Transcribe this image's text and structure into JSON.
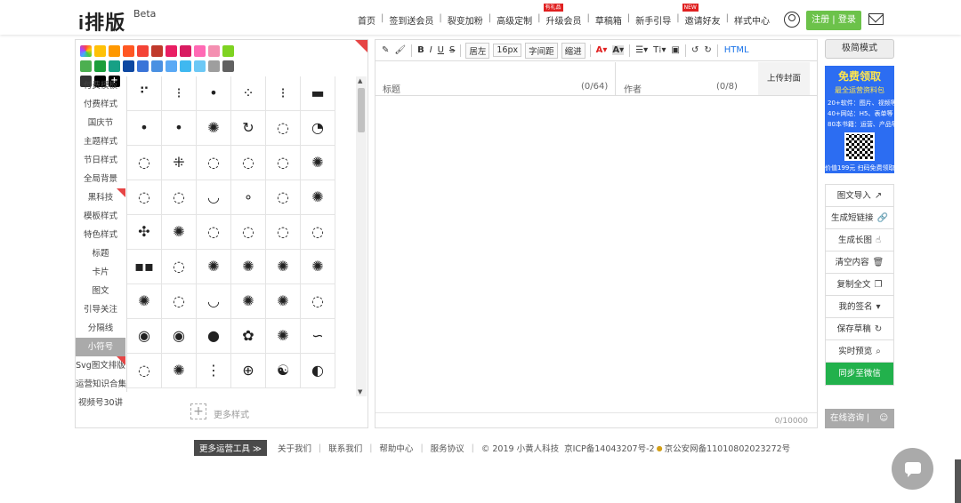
{
  "header": {
    "logo": "i排版",
    "beta": "Beta",
    "nav": [
      {
        "label": "首页"
      },
      {
        "label": "签到送会员"
      },
      {
        "label": "裂变加粉"
      },
      {
        "label": "高级定制"
      },
      {
        "label": "升级会员",
        "tag": "有礼品"
      },
      {
        "label": "草稿箱"
      },
      {
        "label": "新手引导"
      },
      {
        "label": "邀请好友",
        "tag": "NEW"
      },
      {
        "label": "样式中心"
      }
    ],
    "register_login": "注册 | 登录"
  },
  "colors": [
    "#ffffff",
    "#ffc107",
    "#ff9800",
    "#ff5722",
    "#f44336",
    "#c0392b",
    "#e91e63",
    "#d81b60",
    "#ff69b4",
    "#f48fb1",
    "#7ed321",
    "#4caf50",
    "#1a9e3a",
    "#16a085",
    "#0d47a1",
    "#3b74d8",
    "#4a90e2",
    "#5aa9f5",
    "#3fb8f0",
    "#6cc8f5",
    "#9e9e9e",
    "#616161",
    "#333333",
    "#000000"
  ],
  "categories": [
    "付费模板",
    "付费样式",
    "国庆节",
    "主题样式",
    "节日样式",
    "全局背景",
    "黑科技",
    "模板样式",
    "特色样式",
    "标题",
    "卡片",
    "图文",
    "引导关注",
    "分隔线",
    "小符号",
    "Svg图文排版",
    "运营知识合集",
    "视频号30讲"
  ],
  "active_category": "小符号",
  "grid_symbols": [
    [
      "⠋",
      "⁝",
      "•",
      "⁘",
      "⁝",
      "▬"
    ],
    [
      "•",
      "•",
      "✺",
      "↻",
      "◌",
      "◔"
    ],
    [
      "◌",
      "⁜",
      "◌",
      "◌",
      "◌",
      "✺"
    ],
    [
      "◌",
      "◌",
      "◡",
      "∘",
      "◌",
      "✺"
    ],
    [
      "✣",
      "✺",
      "◌",
      "◌",
      "◌",
      "◌"
    ],
    [
      "▪▪",
      "◌",
      "✺",
      "✺",
      "✺",
      "✺"
    ],
    [
      "✺",
      "◌",
      "◡",
      "✺",
      "✺",
      "◌"
    ],
    [
      "◉",
      "◉",
      "●",
      "✿",
      "✺",
      "∽"
    ],
    [
      "◌",
      "✺",
      "⋮",
      "⊕",
      "☯",
      "◐"
    ]
  ],
  "more_styles": "更多样式",
  "toolbar": {
    "bold": "B",
    "italic": "I",
    "underline": "U",
    "strike": "S",
    "align": "居左",
    "font_size": "16px",
    "letter_spacing": "字间距",
    "indent": "缩进",
    "html": "HTML"
  },
  "editor": {
    "title_placeholder": "标题",
    "title_count": "(0/64)",
    "author_placeholder": "作者",
    "author_count": "(0/8)",
    "cover": "上传封面",
    "word_count": "0/10000"
  },
  "right": {
    "simple_mode": "极简模式",
    "promo_title": "免费领取",
    "promo_sub": "最全运营资料包",
    "promo_l1": "20+软件：图片、视频等",
    "promo_l2": "40+网站：H5、表单等",
    "promo_l3": "80本书籍：运营、产品等",
    "promo_bottom": "价值199元 扫码免费领取",
    "actions": [
      "图文导入",
      "生成短链接",
      "生成长图",
      "清空内容",
      "复制全文",
      "我的签名",
      "保存草稿",
      "实时预览"
    ],
    "sync": "同步至微信",
    "consult": "在线咨询 |"
  },
  "footer": {
    "tools": "更多运营工具",
    "links": [
      "关于我们",
      "联系我们",
      "帮助中心",
      "服务协议"
    ],
    "copyright": "© 2019 小黄人科技",
    "icp": "京ICP备14043207号-2",
    "police": "京公安网备11010802023272号"
  }
}
